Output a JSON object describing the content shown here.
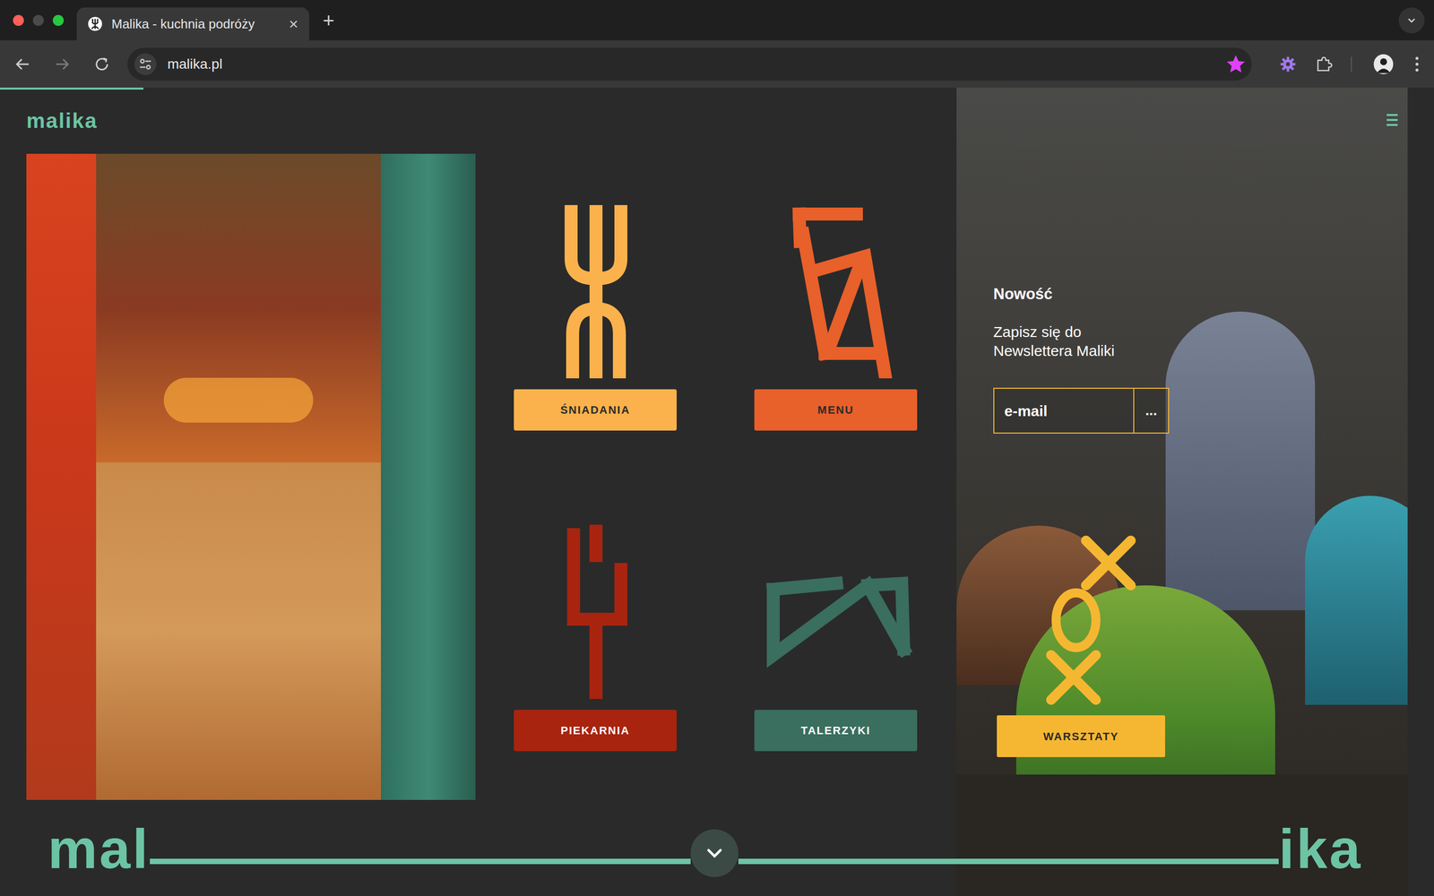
{
  "browser": {
    "tab": {
      "title": "Malika - kuchnia podróży",
      "selected": true,
      "close": "×"
    },
    "new_tab": "+",
    "address": "malika.pl",
    "bookmarked": true,
    "loading": {
      "level": 0.1
    }
  },
  "header": {
    "logo": "malika"
  },
  "tiles": [
    {
      "label": "ŚNIADANIA",
      "color": "#fbb24c",
      "kind": "yaz"
    },
    {
      "label": "MENU",
      "color": "#e8602a",
      "kind": "zag"
    },
    {
      "label": "PIEKARNIA",
      "color": "#a8240f",
      "kind": "fork"
    },
    {
      "label": "TALERZYKI",
      "color": "#3a6e5e",
      "kind": "wave"
    }
  ],
  "newsletter": {
    "badge": "Nowość",
    "text": "Zapisz się do Newslettera Maliki",
    "email_placeholder": "e-mail",
    "submit": "..."
  },
  "workshop_button": "WARSZTATY",
  "footer": {
    "left": "mal",
    "right": "ika"
  }
}
